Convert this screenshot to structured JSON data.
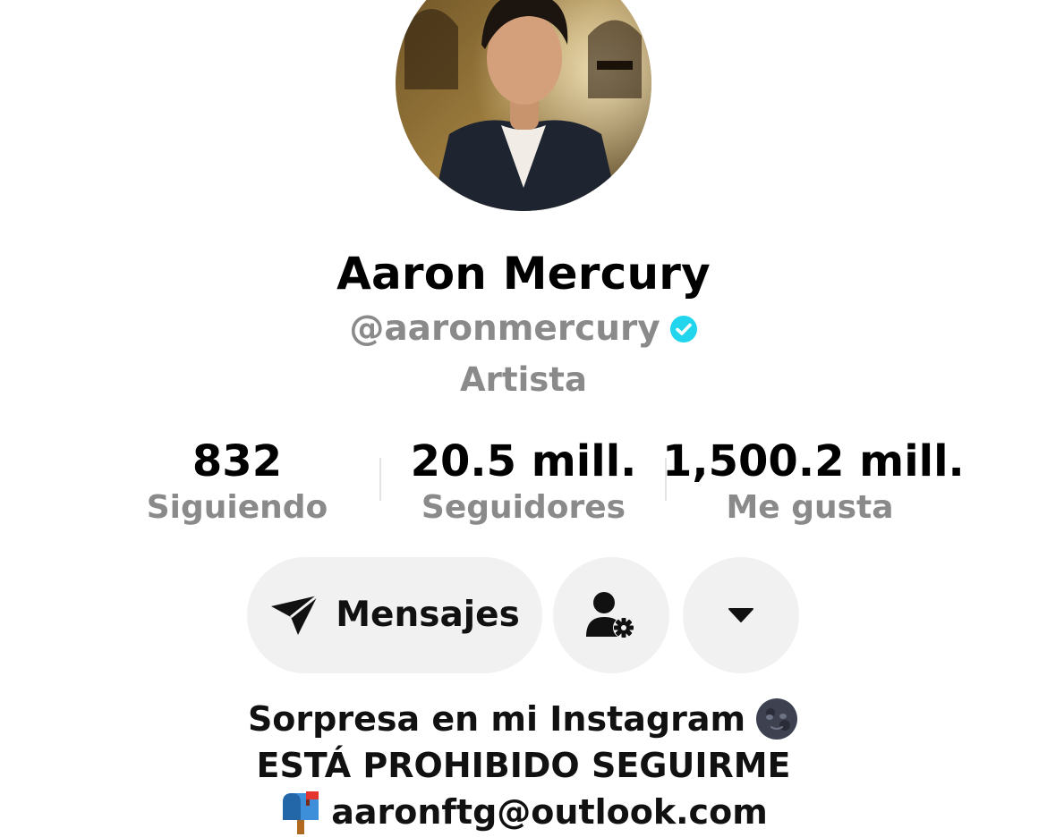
{
  "profile": {
    "display_name": "Aaron Mercury",
    "handle": "@aaronmercury",
    "verified": true,
    "category": "Artista",
    "avatar_icon": "profile-photo"
  },
  "stats": [
    {
      "value": "832",
      "label": "Siguiendo"
    },
    {
      "value": "20.5 mill.",
      "label": "Seguidores"
    },
    {
      "value": "1,500.2 mill.",
      "label": "Me gusta"
    }
  ],
  "actions": {
    "messages_label": "Mensajes",
    "messages_icon": "send-icon",
    "friends_icon": "user-settings-icon",
    "more_icon": "caret-down-icon"
  },
  "bio": {
    "line1": "Sorpresa en mi Instagram",
    "line1_emoji": "new-moon-face",
    "line2": "ESTÁ PROHIBIDO SEGUIRME",
    "line3": "aaronftg@outlook.com",
    "line3_emoji": "mailbox"
  },
  "colors": {
    "secondary_text": "#8a8a8a",
    "button_bg": "#f1f1f1",
    "verified_badge": "#20d5ec"
  }
}
